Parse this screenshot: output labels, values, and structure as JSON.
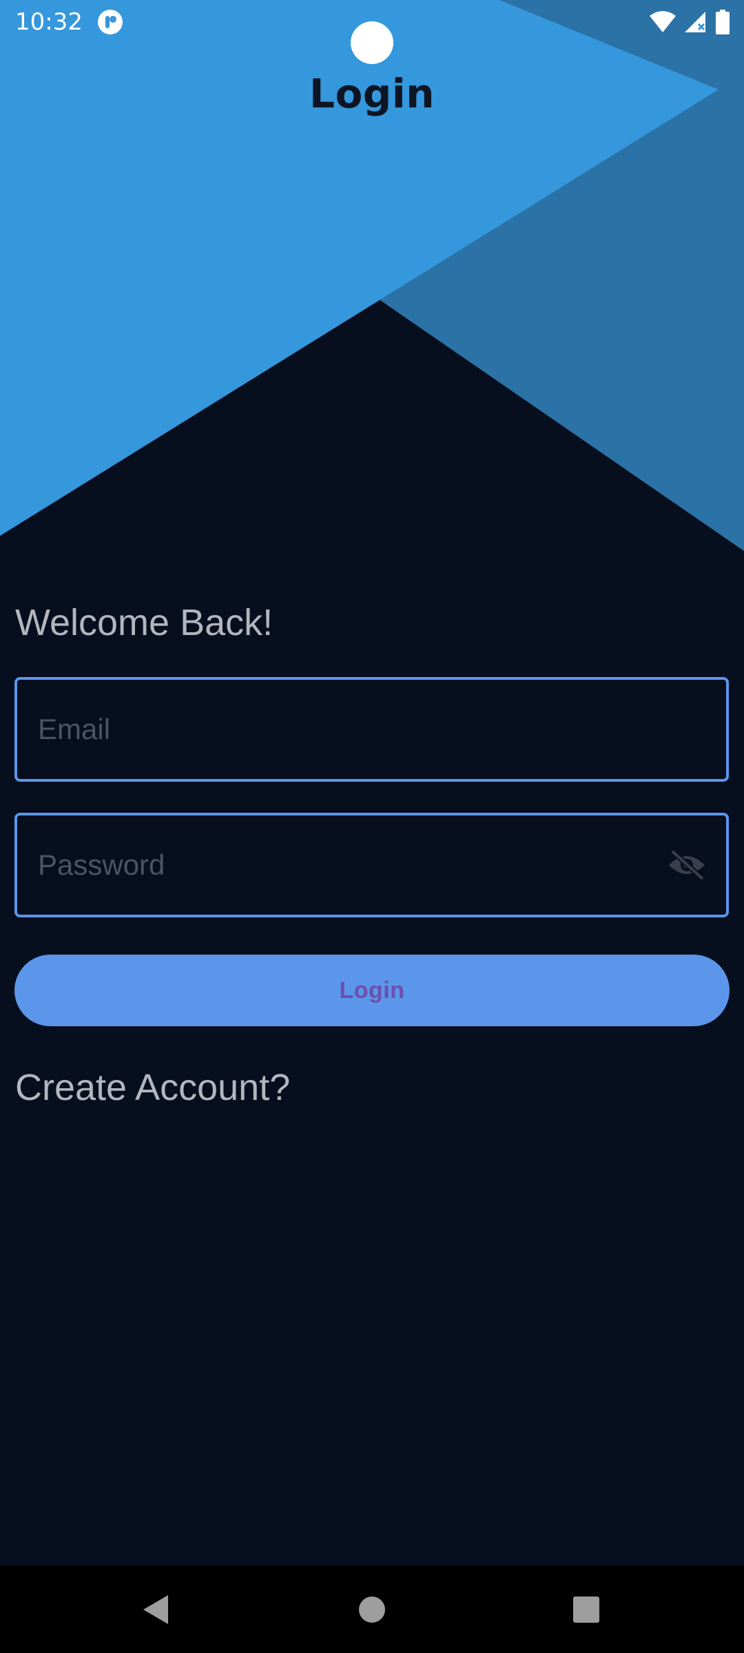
{
  "status_bar": {
    "time": "10:32",
    "app_icon": "p-badge-icon",
    "icons": [
      "wifi-icon",
      "signal-icon",
      "battery-icon"
    ]
  },
  "header": {
    "title": "Login"
  },
  "form": {
    "welcome_text": "Welcome Back!",
    "email_placeholder": "Email",
    "email_value": "",
    "password_placeholder": "Password",
    "password_value": "",
    "password_toggle_icon": "eye-off-icon",
    "login_label": "Login",
    "create_account_label": "Create Account?"
  },
  "nav_bar": {
    "buttons": [
      "back-icon",
      "home-icon",
      "recents-icon"
    ]
  },
  "colors": {
    "background": "#070e1e",
    "hero_light": "#3597dc",
    "hero_dark": "#2b72a6",
    "accent": "#5b96ea",
    "button_text": "#6b4fae",
    "muted_text": "#b3b6bd",
    "placeholder": "#4c5363"
  }
}
